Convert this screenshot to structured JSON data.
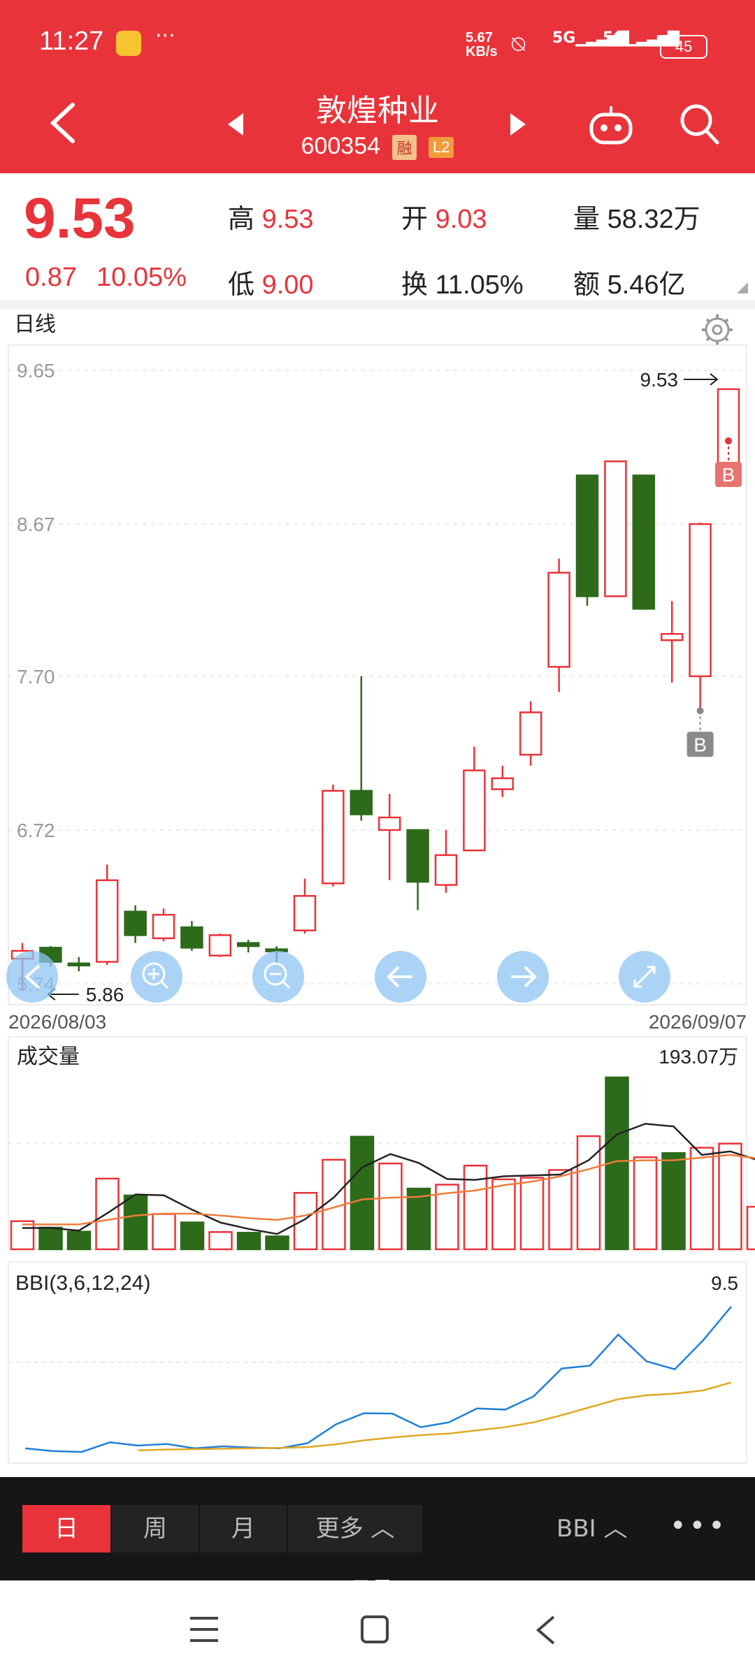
{
  "status_bar": {
    "time": "11:27",
    "net_speed_value": "5.67",
    "net_speed_unit": "KB/s",
    "signal1": "5G",
    "signal2": "5G",
    "battery": "45"
  },
  "header": {
    "stock_name": "敦煌种业",
    "stock_code": "600354",
    "badge_rong": "融",
    "badge_l2": "L2"
  },
  "quote": {
    "price": "9.53",
    "change": "0.87",
    "change_pct": "10.05%",
    "high_label": "高",
    "high": "9.53",
    "low_label": "低",
    "low": "9.00",
    "open_label": "开",
    "open": "9.03",
    "turnover_label": "换",
    "turnover": "11.05%",
    "volume_label": "量",
    "volume": "58.32万",
    "amount_label": "额",
    "amount": "5.46亿"
  },
  "main_chart": {
    "period_label": "日线",
    "date_start": "2026/08/03",
    "date_end": "2026/09/07",
    "max_label": "9.53",
    "min_label": "5.86",
    "marker": "B",
    "y_ticks": [
      "9.65",
      "8.67",
      "7.70",
      "6.72",
      "5.74"
    ]
  },
  "volume_chart": {
    "title": "成交量",
    "max_label": "193.07万"
  },
  "bbi_chart": {
    "title": "BBI(3,6,12,24)",
    "value": "9.5"
  },
  "bottom_tabs": {
    "day": "日",
    "week": "周",
    "month": "月",
    "more": "更多",
    "indicator": "BBI"
  },
  "chart_data": [
    {
      "type": "candlestick",
      "title": "日线",
      "x_range": [
        "2026/08/03",
        "2026/09/07"
      ],
      "ylim": [
        5.74,
        9.65
      ],
      "y_ticks": [
        9.65,
        8.67,
        7.7,
        6.72,
        5.74
      ],
      "candles": [
        {
          "open": 5.9,
          "high": 6.0,
          "low": 5.7,
          "close": 5.95
        },
        {
          "open": 5.97,
          "high": 5.98,
          "low": 5.85,
          "close": 5.88
        },
        {
          "open": 5.87,
          "high": 5.91,
          "low": 5.82,
          "close": 5.86
        },
        {
          "open": 5.88,
          "high": 6.5,
          "low": 5.86,
          "close": 6.4
        },
        {
          "open": 6.2,
          "high": 6.24,
          "low": 6.0,
          "close": 6.05
        },
        {
          "open": 6.03,
          "high": 6.22,
          "low": 6.01,
          "close": 6.18
        },
        {
          "open": 6.1,
          "high": 6.14,
          "low": 5.95,
          "close": 5.97
        },
        {
          "open": 5.92,
          "high": 6.06,
          "low": 5.91,
          "close": 6.05
        },
        {
          "open": 6.0,
          "high": 6.02,
          "low": 5.94,
          "close": 5.98
        },
        {
          "open": 5.96,
          "high": 5.98,
          "low": 5.86,
          "close": 5.95
        },
        {
          "open": 6.08,
          "high": 6.41,
          "low": 6.06,
          "close": 6.3
        },
        {
          "open": 6.38,
          "high": 7.01,
          "low": 6.36,
          "close": 6.97
        },
        {
          "open": 6.97,
          "high": 7.7,
          "low": 6.78,
          "close": 6.82
        },
        {
          "open": 6.72,
          "high": 6.95,
          "low": 6.4,
          "close": 6.8
        },
        {
          "open": 6.72,
          "high": 6.72,
          "low": 6.21,
          "close": 6.39
        },
        {
          "open": 6.37,
          "high": 6.72,
          "low": 6.32,
          "close": 6.56
        },
        {
          "open": 6.59,
          "high": 7.25,
          "low": 6.59,
          "close": 7.1
        },
        {
          "open": 6.98,
          "high": 7.13,
          "low": 6.93,
          "close": 7.05
        },
        {
          "open": 7.2,
          "high": 7.54,
          "low": 7.13,
          "close": 7.47
        },
        {
          "open": 7.76,
          "high": 8.45,
          "low": 7.6,
          "close": 8.36
        },
        {
          "open": 8.98,
          "high": 8.98,
          "low": 8.15,
          "close": 8.21
        },
        {
          "open": 8.21,
          "high": 9.07,
          "low": 8.21,
          "close": 9.07
        },
        {
          "open": 8.98,
          "high": 8.98,
          "low": 8.13,
          "close": 8.13
        },
        {
          "open": 7.93,
          "high": 8.18,
          "low": 7.66,
          "close": 7.97
        },
        {
          "open": 7.7,
          "high": 8.68,
          "low": 7.48,
          "close": 8.67
        },
        {
          "open": 9.03,
          "high": 9.53,
          "low": 9.0,
          "close": 9.53
        }
      ]
    },
    {
      "type": "bar",
      "title": "成交量",
      "unit": "万",
      "ylim": [
        0,
        193.07
      ],
      "values": [
        31.6,
        24.4,
        19.8,
        79.4,
        60.5,
        39.6,
        30.2,
        19.4,
        18.6,
        14.5,
        63.4,
        100.6,
        126.5,
        96.4,
        68.2,
        72.6,
        94.0,
        78.6,
        80.4,
        89.1,
        127.1,
        193.07,
        103.4,
        108.1,
        114.1,
        118.7,
        47.8
      ],
      "colors": [
        "up",
        "down",
        "down",
        "up",
        "down",
        "up",
        "down",
        "up",
        "down",
        "down",
        "up",
        "up",
        "down",
        "up",
        "down",
        "up",
        "up",
        "up",
        "up",
        "up",
        "up",
        "down",
        "up",
        "down",
        "up",
        "up",
        "up"
      ],
      "ma_short": [
        23.9,
        23.9,
        21.0,
        40.6,
        61.6,
        60.6,
        44.4,
        30.0,
        22.8,
        17.2,
        34.1,
        58.2,
        92.0,
        107.0,
        97.0,
        79.0,
        78.0,
        82.0,
        83.0,
        84.0,
        100.0,
        129.0,
        141.0,
        138.0,
        106.0,
        110.0,
        100.0
      ],
      "ma_long": [
        28.0,
        28.0,
        28.0,
        33.0,
        38.0,
        40.0,
        40.0,
        38.0,
        35.0,
        33.0,
        38.0,
        47.0,
        56.0,
        58.0,
        59.0,
        63.0,
        66.0,
        72.0,
        76.0,
        82.0,
        90.0,
        99.0,
        100.0,
        100.0,
        103.0,
        106.0,
        102.0
      ]
    },
    {
      "type": "line",
      "title": "BBI(3,6,12,24)",
      "series": [
        {
          "name": "BBI",
          "values": [
            5.95,
            5.88,
            5.86,
            6.1,
            6.02,
            6.06,
            5.95,
            6.0,
            5.97,
            5.95,
            6.08,
            6.55,
            6.83,
            6.82,
            6.48,
            6.6,
            6.95,
            6.92,
            7.25,
            7.95,
            8.02,
            8.8,
            8.13,
            7.93,
            8.65,
            9.5
          ]
        },
        {
          "name": "",
          "values": [
            null,
            null,
            null,
            null,
            5.9,
            5.92,
            5.93,
            5.94,
            5.95,
            5.96,
            5.98,
            6.05,
            6.15,
            6.22,
            6.28,
            6.32,
            6.4,
            6.48,
            6.6,
            6.78,
            6.98,
            7.18,
            7.28,
            7.32,
            7.4,
            7.6
          ]
        }
      ]
    }
  ]
}
